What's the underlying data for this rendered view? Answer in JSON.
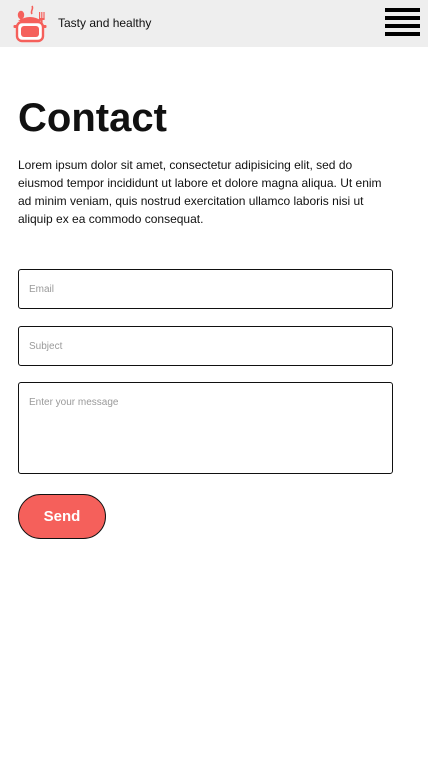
{
  "header": {
    "brand_text": "Tasty and healthy",
    "logo_icon": "cooking-pot-logo-icon",
    "menu_icon": "hamburger-menu-icon",
    "background_color": "#eeeeee"
  },
  "main": {
    "title": "Contact",
    "intro": "Lorem ipsum dolor sit amet, consectetur adipisicing elit, sed do eiusmod tempor incididunt ut labore et dolore magna aliqua. Ut enim ad minim veniam, quis nostrud exercitation ullamco laboris nisi ut aliquip ex ea commodo consequat."
  },
  "form": {
    "email_placeholder": "Email",
    "subject_placeholder": "Subject",
    "message_placeholder": "Enter your message",
    "email_value": "",
    "subject_value": "",
    "message_value": "",
    "send_label": "Send"
  },
  "colors": {
    "accent": "#f5605b",
    "text": "#111111",
    "placeholder": "#9a9a9a"
  }
}
